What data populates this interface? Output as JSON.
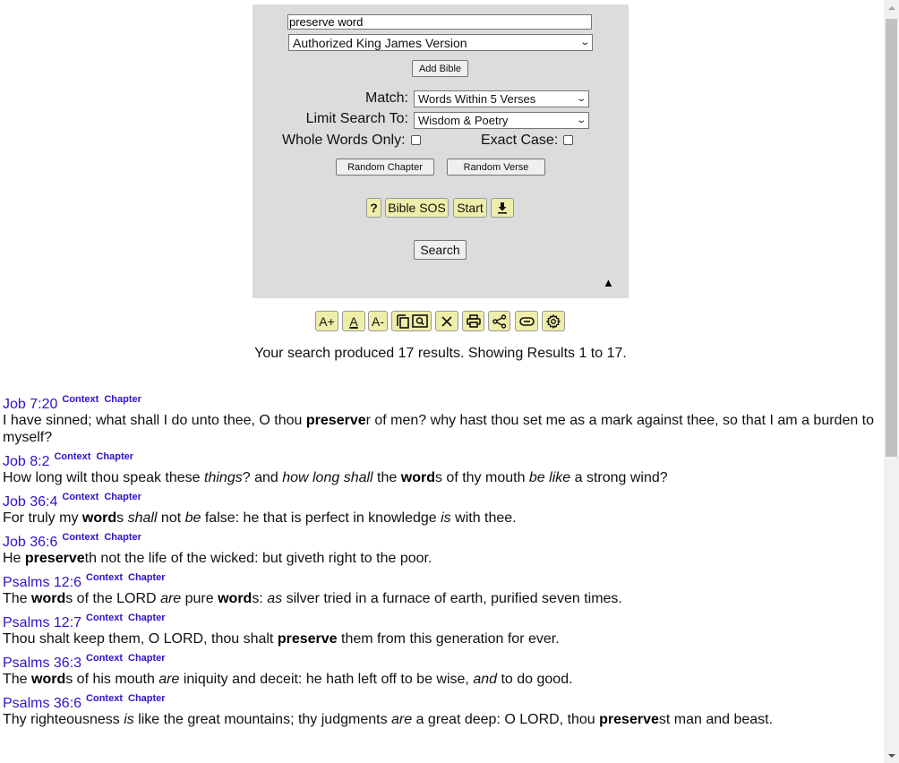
{
  "search": {
    "query": "preserve word",
    "version": "Authorized King James Version",
    "add_bible_label": "Add Bible",
    "match_label": "Match:",
    "match_value": "Words Within 5 Verses",
    "limit_label": "Limit Search To:",
    "limit_value": "Wisdom & Poetry",
    "whole_words_label": "Whole Words Only:",
    "whole_words_checked": false,
    "exact_case_label": "Exact Case:",
    "exact_case_checked": false,
    "random_chapter_label": "Random Chapter",
    "random_verse_label": "Random Verse",
    "help_label": "?",
    "bible_sos_label": "Bible SOS",
    "start_label": "Start",
    "download_icon": "download-icon",
    "search_label": "Search",
    "collapse_glyph": "▲"
  },
  "toolbar": {
    "increase_font_label": "A+",
    "default_font_label": "A",
    "decrease_font_label": "A-",
    "icons": [
      "copy-icon",
      "search-in-page-icon",
      "close-icon",
      "print-icon",
      "share-icon",
      "link-icon",
      "gear-icon"
    ]
  },
  "summary": "Your search produced 17 results.  Showing Results 1 to 17.",
  "colors": {
    "panel_bg": "#dcdcdc",
    "yellow_button": "#eeeeaa",
    "link": "#3311cc"
  },
  "results": [
    {
      "ref": "Job 7:20",
      "context": "Context",
      "chapter": "Chapter",
      "segments": [
        [
          "t",
          "I have sinned; what shall I do unto thee, O thou "
        ],
        [
          "b",
          "preserve"
        ],
        [
          "t",
          "r of men? why hast thou set me as a mark against thee, so that I am a burden to myself?"
        ]
      ]
    },
    {
      "ref": "Job 8:2",
      "context": "Context",
      "chapter": "Chapter",
      "segments": [
        [
          "t",
          "How long wilt thou speak these "
        ],
        [
          "i",
          "things"
        ],
        [
          "t",
          "? and "
        ],
        [
          "i",
          "how long shall"
        ],
        [
          "t",
          " the "
        ],
        [
          "b",
          "word"
        ],
        [
          "t",
          "s of thy mouth "
        ],
        [
          "i",
          "be like"
        ],
        [
          "t",
          " a strong wind?"
        ]
      ]
    },
    {
      "ref": "Job 36:4",
      "context": "Context",
      "chapter": "Chapter",
      "segments": [
        [
          "t",
          "For truly my "
        ],
        [
          "b",
          "word"
        ],
        [
          "t",
          "s "
        ],
        [
          "i",
          "shall"
        ],
        [
          "t",
          " not "
        ],
        [
          "i",
          "be"
        ],
        [
          "t",
          " false: he that is perfect in knowledge "
        ],
        [
          "i",
          "is"
        ],
        [
          "t",
          " with thee."
        ]
      ]
    },
    {
      "ref": "Job 36:6",
      "context": "Context",
      "chapter": "Chapter",
      "segments": [
        [
          "t",
          "He "
        ],
        [
          "b",
          "preserve"
        ],
        [
          "t",
          "th not the life of the wicked: but giveth right to the poor."
        ]
      ]
    },
    {
      "ref": "Psalms 12:6",
      "context": "Context",
      "chapter": "Chapter",
      "segments": [
        [
          "t",
          "The "
        ],
        [
          "b",
          "word"
        ],
        [
          "t",
          "s of the LORD "
        ],
        [
          "i",
          "are"
        ],
        [
          "t",
          " pure "
        ],
        [
          "b",
          "word"
        ],
        [
          "t",
          "s: "
        ],
        [
          "i",
          "as"
        ],
        [
          "t",
          " silver tried in a furnace of earth, purified seven times."
        ]
      ]
    },
    {
      "ref": "Psalms 12:7",
      "context": "Context",
      "chapter": "Chapter",
      "segments": [
        [
          "t",
          "Thou shalt keep them, O LORD, thou shalt "
        ],
        [
          "b",
          "preserve"
        ],
        [
          "t",
          " them from this generation for ever."
        ]
      ]
    },
    {
      "ref": "Psalms 36:3",
      "context": "Context",
      "chapter": "Chapter",
      "segments": [
        [
          "t",
          "The "
        ],
        [
          "b",
          "word"
        ],
        [
          "t",
          "s of his mouth "
        ],
        [
          "i",
          "are"
        ],
        [
          "t",
          " iniquity and deceit: he hath left off to be wise, "
        ],
        [
          "i",
          "and"
        ],
        [
          "t",
          " to do good."
        ]
      ]
    },
    {
      "ref": "Psalms 36:6",
      "context": "Context",
      "chapter": "Chapter",
      "segments": [
        [
          "t",
          "Thy righteousness "
        ],
        [
          "i",
          "is"
        ],
        [
          "t",
          " like the great mountains; thy judgments "
        ],
        [
          "i",
          "are"
        ],
        [
          "t",
          " a great deep: O LORD, thou "
        ],
        [
          "b",
          "preserve"
        ],
        [
          "t",
          "st man and beast."
        ]
      ]
    }
  ]
}
